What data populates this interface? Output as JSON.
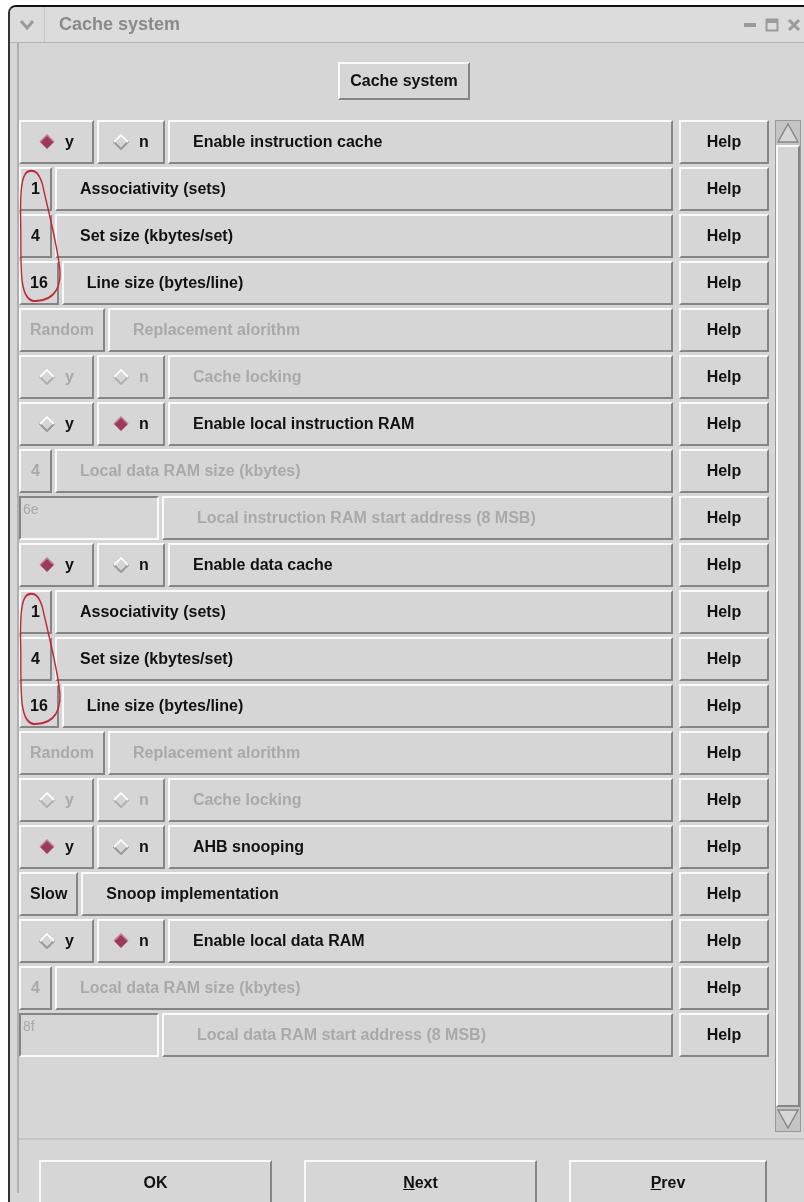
{
  "window": {
    "title": "Cache system"
  },
  "header_button": "Cache system",
  "rows": [
    {
      "kind": "yn",
      "options": [
        {
          "label": "y",
          "selected": true
        },
        {
          "label": "n",
          "selected": false
        }
      ],
      "label": "Enable instruction cache",
      "disabled": false,
      "circled": false,
      "help": "Help"
    },
    {
      "kind": "choice",
      "value": "1",
      "label": "Associativity (sets)",
      "disabled": false,
      "circled": true,
      "help": "Help"
    },
    {
      "kind": "choice",
      "value": "4",
      "label": "Set size (kbytes/set)",
      "disabled": false,
      "circled": true,
      "help": "Help"
    },
    {
      "kind": "choice",
      "value": "16",
      "label": "Line size (bytes/line)",
      "disabled": false,
      "circled": true,
      "help": "Help"
    },
    {
      "kind": "choice",
      "value": "Random",
      "label": "Replacement alorithm",
      "disabled": true,
      "circled": false,
      "help": "Help"
    },
    {
      "kind": "yn",
      "options": [
        {
          "label": "y",
          "selected": false
        },
        {
          "label": "n",
          "selected": false
        }
      ],
      "label": "Cache locking",
      "disabled": true,
      "circled": false,
      "help": "Help"
    },
    {
      "kind": "yn",
      "options": [
        {
          "label": "y",
          "selected": false
        },
        {
          "label": "n",
          "selected": true
        }
      ],
      "label": "Enable local instruction RAM",
      "disabled": false,
      "circled": false,
      "help": "Help"
    },
    {
      "kind": "choice",
      "value": "4",
      "label": "Local data RAM size (kbytes)",
      "disabled": true,
      "circled": false,
      "help": "Help"
    },
    {
      "kind": "entry",
      "value": "6e",
      "label": "Local instruction RAM start address (8 MSB)",
      "disabled": true,
      "circled": false,
      "help": "Help"
    },
    {
      "kind": "yn",
      "options": [
        {
          "label": "y",
          "selected": true
        },
        {
          "label": "n",
          "selected": false
        }
      ],
      "label": "Enable data cache",
      "disabled": false,
      "circled": false,
      "help": "Help"
    },
    {
      "kind": "choice",
      "value": "1",
      "label": "Associativity (sets)",
      "disabled": false,
      "circled": true,
      "help": "Help"
    },
    {
      "kind": "choice",
      "value": "4",
      "label": "Set size (kbytes/set)",
      "disabled": false,
      "circled": true,
      "help": "Help"
    },
    {
      "kind": "choice",
      "value": "16",
      "label": "Line size (bytes/line)",
      "disabled": false,
      "circled": true,
      "help": "Help"
    },
    {
      "kind": "choice",
      "value": "Random",
      "label": "Replacement alorithm",
      "disabled": true,
      "circled": false,
      "help": "Help"
    },
    {
      "kind": "yn",
      "options": [
        {
          "label": "y",
          "selected": false
        },
        {
          "label": "n",
          "selected": false
        }
      ],
      "label": "Cache locking",
      "disabled": true,
      "circled": false,
      "help": "Help"
    },
    {
      "kind": "yn",
      "options": [
        {
          "label": "y",
          "selected": true
        },
        {
          "label": "n",
          "selected": false
        }
      ],
      "label": "AHB snooping",
      "disabled": false,
      "circled": false,
      "help": "Help"
    },
    {
      "kind": "choice",
      "value": "Slow",
      "label": "Snoop implementation",
      "disabled": false,
      "circled": false,
      "help": "Help"
    },
    {
      "kind": "yn",
      "options": [
        {
          "label": "y",
          "selected": false
        },
        {
          "label": "n",
          "selected": true
        }
      ],
      "label": "Enable local data RAM",
      "disabled": false,
      "circled": false,
      "help": "Help"
    },
    {
      "kind": "choice",
      "value": "4",
      "label": "Local data RAM size (kbytes)",
      "disabled": true,
      "circled": false,
      "help": "Help"
    },
    {
      "kind": "entry",
      "value": "8f",
      "label": "Local data RAM start address (8 MSB)",
      "disabled": true,
      "circled": false,
      "help": "Help"
    }
  ],
  "buttons": [
    {
      "label": "OK",
      "underline_first": false
    },
    {
      "label": "Next",
      "underline_first": true
    },
    {
      "label": "Prev",
      "underline_first": true
    }
  ]
}
